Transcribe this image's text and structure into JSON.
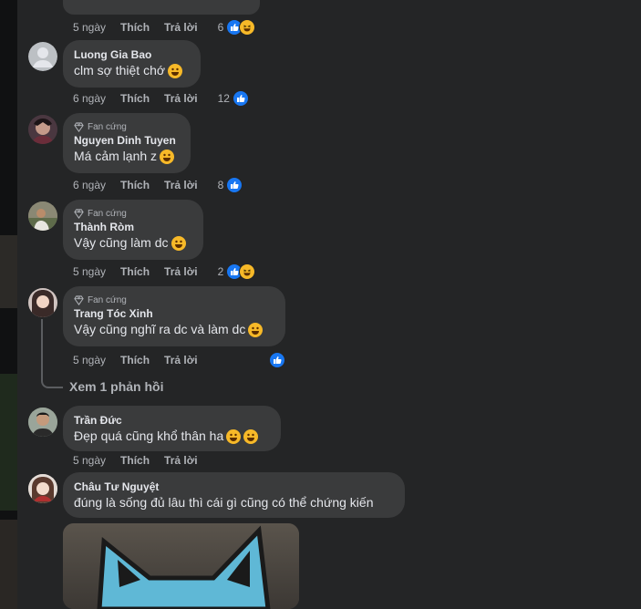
{
  "colors": {
    "like": "#1877f2",
    "haha": "#f7b928",
    "bubble": "#3a3b3c",
    "panel": "#242526"
  },
  "labels": {
    "like": "Thích",
    "reply": "Trả lời",
    "fan_badge": "Fan cứng",
    "view_replies": "Xem 1 phản hồi"
  },
  "comments": [
    {
      "time": "5 ngày",
      "reaction_count": "6",
      "reactions": [
        "like-icon",
        "haha-icon"
      ]
    },
    {
      "author": "Luong Gia Bao",
      "text": "clm sợ thiệt chớ",
      "time": "6 ngày",
      "reaction_count": "12",
      "reactions": [
        "like-icon"
      ]
    },
    {
      "author": "Nguyen Dinh Tuyen",
      "text": "Má cảm lạnh z",
      "time": "6 ngày",
      "reaction_count": "8",
      "reactions": [
        "like-icon"
      ]
    },
    {
      "author": "Thành Ròm",
      "text": "Vậy cũng làm dc",
      "time": "5 ngày",
      "reaction_count": "2",
      "reactions": [
        "like-icon",
        "haha-icon"
      ]
    },
    {
      "author": "Trang Tóc Xinh",
      "text": "Vậy cũng nghĩ ra dc và làm dc",
      "time": "5 ngày",
      "reaction_count": "",
      "reactions": [
        "like-icon"
      ]
    },
    {
      "author": "Trần Đức",
      "text": "Đẹp quá cũng khổ thân ha",
      "time": "5 ngày"
    },
    {
      "author": "Châu Tư Nguyệt",
      "text": "đúng là sống đủ lâu thì cái gì cũng có thể chứng kiến"
    }
  ]
}
